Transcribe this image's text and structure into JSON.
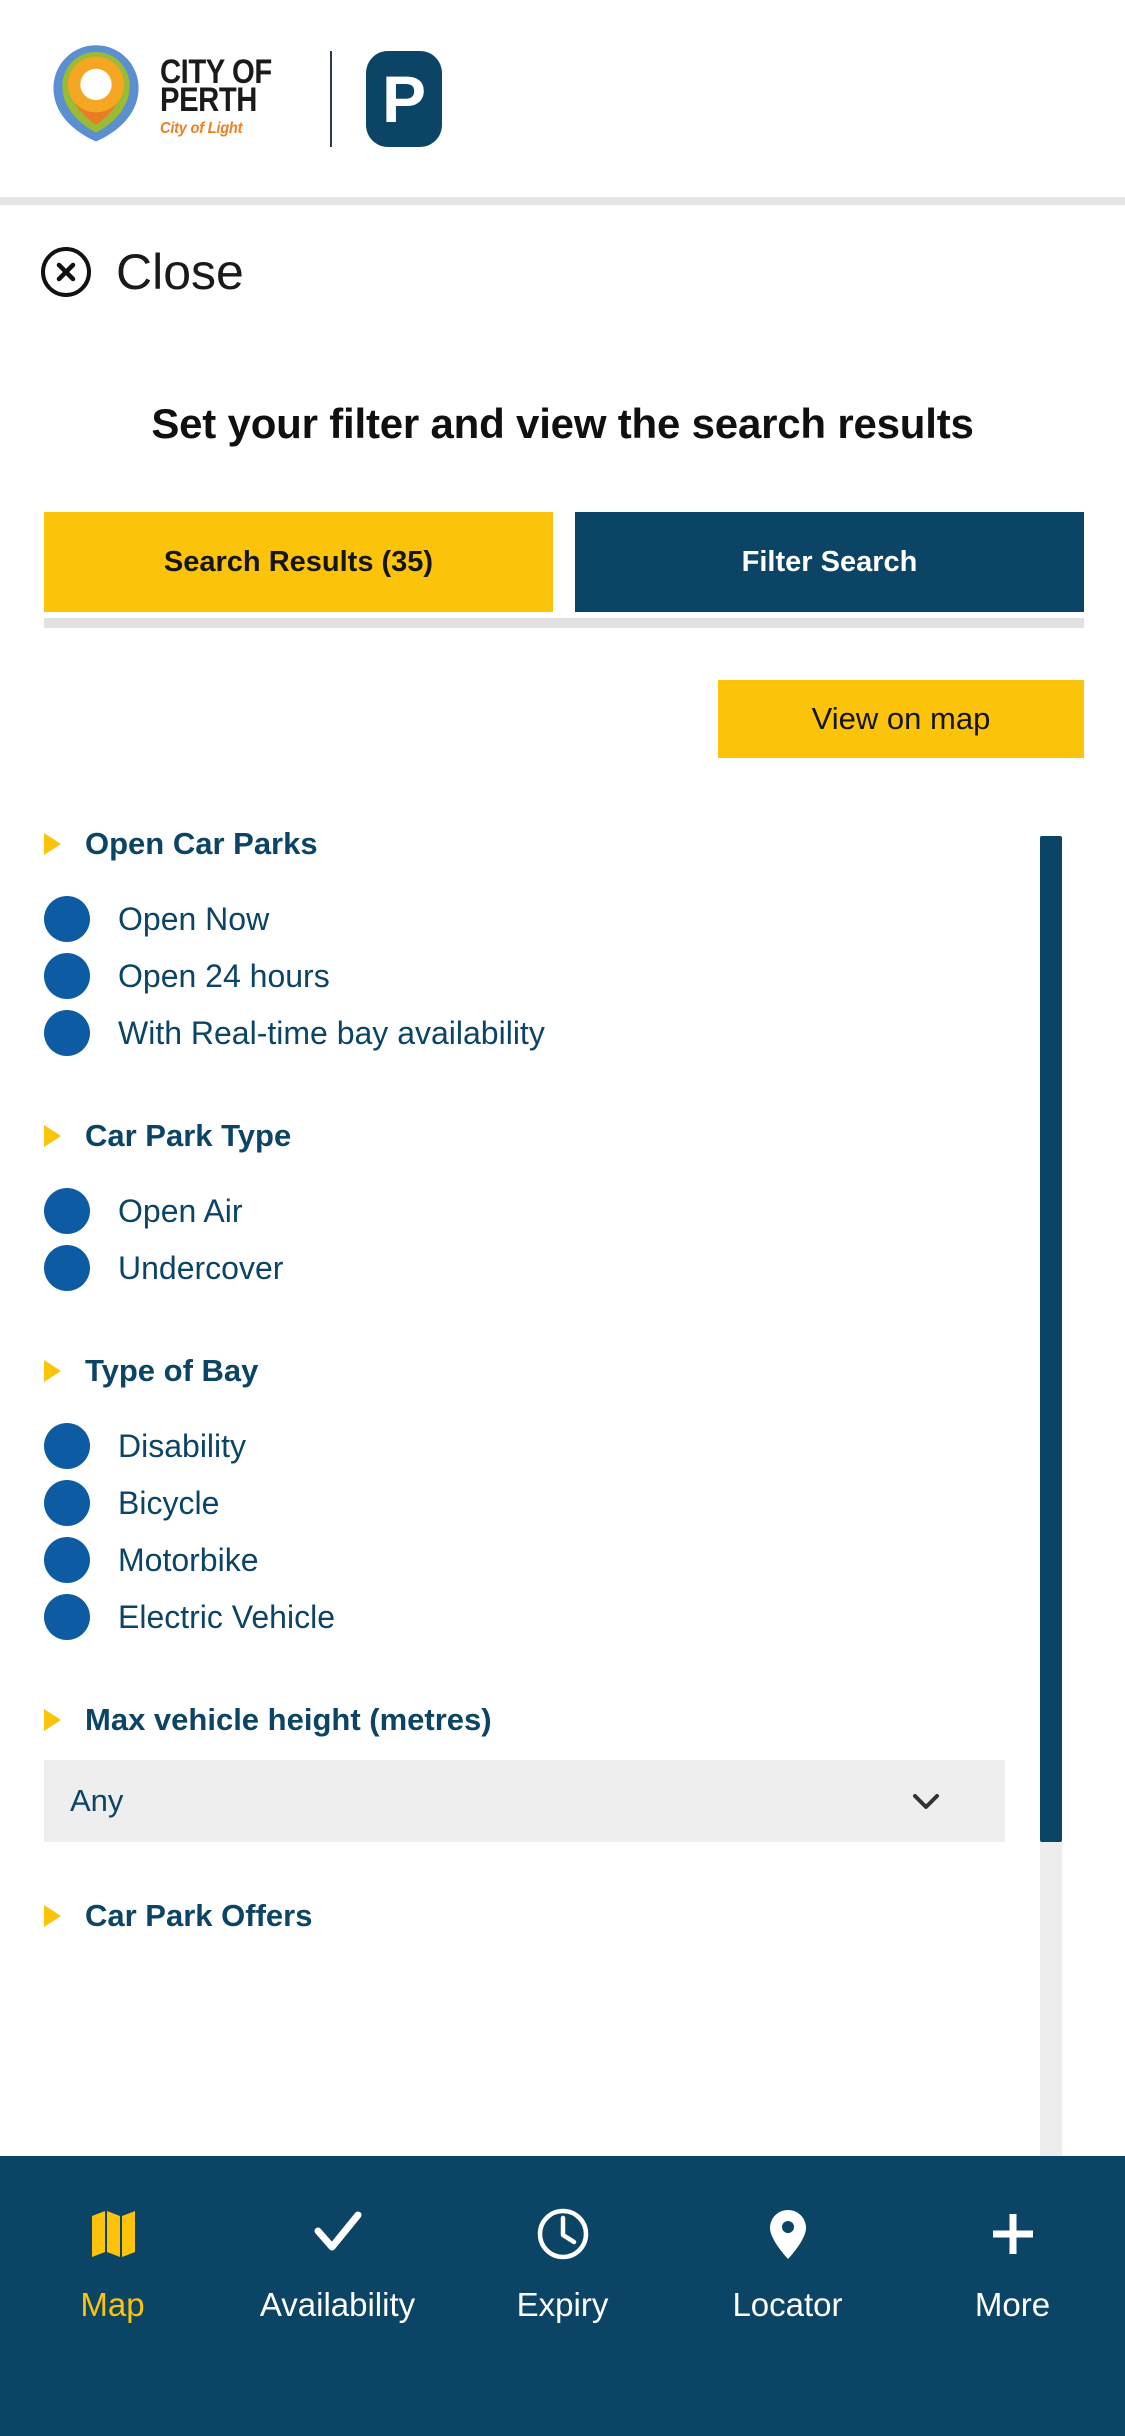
{
  "brand": {
    "logo_icon": "city-of-perth-arcs-logo",
    "wordmark_line1": "CITY OF",
    "wordmark_line2": "PERTH",
    "tagline": "City of Light",
    "parking_badge": "P",
    "parking_badge_icon": "parking-p-badge"
  },
  "close_bar": {
    "icon": "close-circle-icon",
    "label": "Close"
  },
  "heading": "Set your filter and view the search results",
  "tabs": [
    {
      "label": "Search Results (35)",
      "state": "active"
    },
    {
      "label": "Filter Search",
      "state": "inactive"
    }
  ],
  "actions": {
    "view_on_map": "View on map"
  },
  "filter_groups": [
    {
      "title": "Open Car Parks",
      "caret_icon": "caret-right-icon",
      "options": [
        {
          "label": "Open Now",
          "icon": "filled-circle-toggle"
        },
        {
          "label": "Open 24 hours",
          "icon": "filled-circle-toggle"
        },
        {
          "label": "With Real-time bay availability",
          "icon": "filled-circle-toggle"
        }
      ]
    },
    {
      "title": "Car Park Type",
      "caret_icon": "caret-right-icon",
      "options": [
        {
          "label": "Open Air",
          "icon": "filled-circle-toggle"
        },
        {
          "label": "Undercover",
          "icon": "filled-circle-toggle"
        }
      ]
    },
    {
      "title": "Type of Bay",
      "caret_icon": "caret-right-icon",
      "options": [
        {
          "label": "Disability",
          "icon": "filled-circle-toggle"
        },
        {
          "label": "Bicycle",
          "icon": "filled-circle-toggle"
        },
        {
          "label": "Motorbike",
          "icon": "filled-circle-toggle"
        },
        {
          "label": "Electric Vehicle",
          "icon": "filled-circle-toggle"
        }
      ]
    },
    {
      "title": "Max vehicle height (metres)",
      "caret_icon": "caret-right-icon",
      "select": {
        "value": "Any",
        "chevron_icon": "chevron-down-icon"
      },
      "options": []
    },
    {
      "title": "Car Park Offers",
      "caret_icon": "caret-right-icon",
      "options": []
    }
  ],
  "bottom_nav": [
    {
      "label": "Map",
      "icon": "map-icon",
      "state": "active"
    },
    {
      "label": "Availability",
      "icon": "check-icon",
      "state": "inactive"
    },
    {
      "label": "Expiry",
      "icon": "clock-icon",
      "state": "inactive"
    },
    {
      "label": "Locator",
      "icon": "location-pin-icon",
      "state": "inactive"
    },
    {
      "label": "More",
      "icon": "plus-icon",
      "state": "inactive"
    }
  ],
  "colors": {
    "brand_navy": "#0b4465",
    "brand_gold": "#fbc40a",
    "option_blue": "#0c5ba3",
    "tagline_orange": "#ef8022"
  }
}
